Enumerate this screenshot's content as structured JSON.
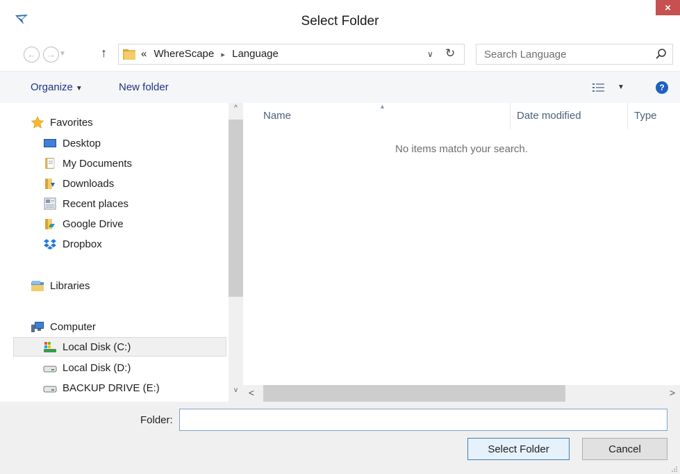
{
  "window": {
    "title": "Select Folder",
    "close_label": "×"
  },
  "navigation": {
    "back_glyph": "←",
    "forward_glyph": "→",
    "up_glyph": "↑",
    "address": {
      "overflow": "«",
      "segments": [
        "WhereScape",
        "Language"
      ],
      "separator": "▸"
    },
    "search": {
      "placeholder": "Search Language"
    }
  },
  "toolbar": {
    "organize_label": "Organize",
    "new_folder_label": "New folder"
  },
  "nav_pane": {
    "favorites": {
      "label": "Favorites",
      "items": [
        {
          "label": "Desktop",
          "icon": "desktop-icon"
        },
        {
          "label": "My Documents",
          "icon": "documents-icon"
        },
        {
          "label": "Downloads",
          "icon": "downloads-icon"
        },
        {
          "label": "Recent places",
          "icon": "recent-places-icon"
        },
        {
          "label": "Google Drive",
          "icon": "google-drive-icon"
        },
        {
          "label": "Dropbox",
          "icon": "dropbox-icon"
        }
      ]
    },
    "libraries_label": "Libraries",
    "computer": {
      "label": "Computer",
      "items": [
        {
          "label": "Local Disk (C:)",
          "icon": "system-drive-icon",
          "selected": true
        },
        {
          "label": "Local Disk (D:)",
          "icon": "drive-icon"
        },
        {
          "label": "BACKUP DRIVE (E:)",
          "icon": "drive-icon"
        }
      ]
    }
  },
  "file_list": {
    "columns": [
      "Name",
      "Date modified",
      "Type"
    ],
    "sort_column": "Name",
    "empty_message": "No items match your search."
  },
  "footer": {
    "folder_label": "Folder:",
    "folder_value": "",
    "select_button": "Select Folder",
    "cancel_button": "Cancel"
  },
  "colors": {
    "close_button": "#c75050",
    "link_text": "#1e3287",
    "default_button_border": "#3c7fb1",
    "selection_bg": "#f0f0f0"
  }
}
